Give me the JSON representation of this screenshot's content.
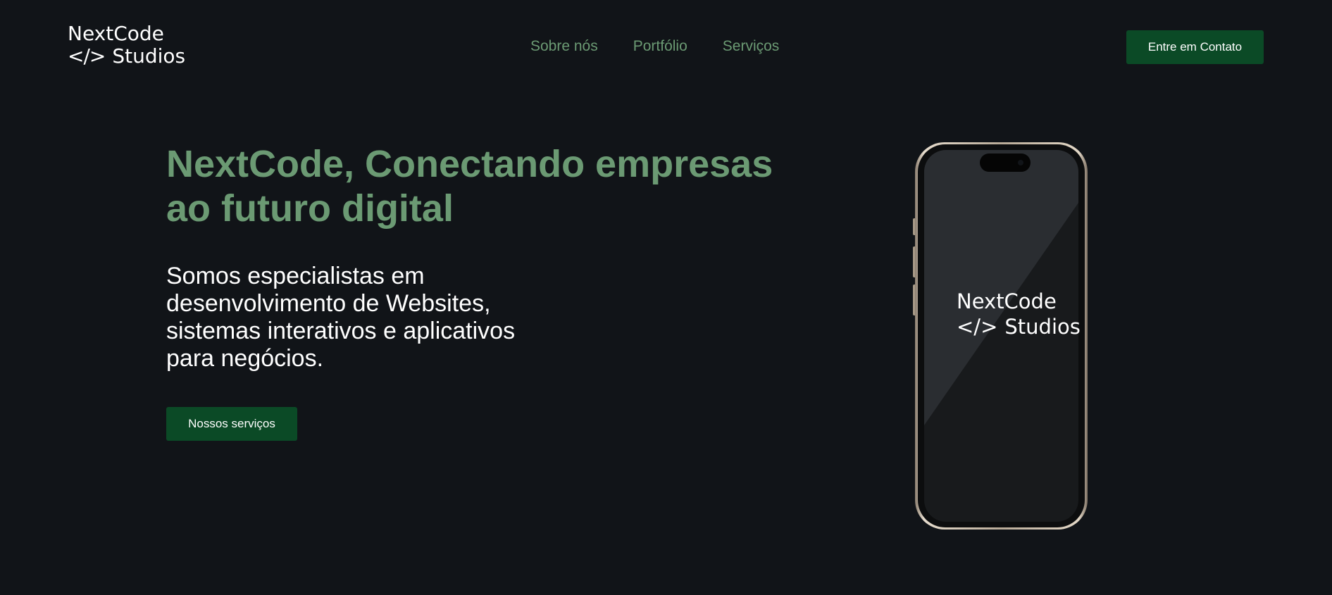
{
  "header": {
    "logo": {
      "line1": "NextCode",
      "code_symbol": "</>",
      "line2": "Studios"
    },
    "nav": [
      {
        "label": "Sobre nós"
      },
      {
        "label": "Portfólio"
      },
      {
        "label": "Serviços"
      }
    ],
    "contact_label": "Entre em Contato"
  },
  "hero": {
    "title": "NextCode, Conectando empresas ao futuro digital",
    "description": "Somos especialistas em desenvolvimento de Websites, sistemas interativos e aplicativos para negócios.",
    "cta_label": "Nossos serviços"
  },
  "phone": {
    "logo_line1": "NextCode",
    "logo_code_symbol": "</>",
    "logo_line2": "Studios"
  },
  "colors": {
    "background": "#111418",
    "accent_green": "#6b9a73",
    "button_green": "#0b4a26",
    "text_white": "#ffffff"
  }
}
